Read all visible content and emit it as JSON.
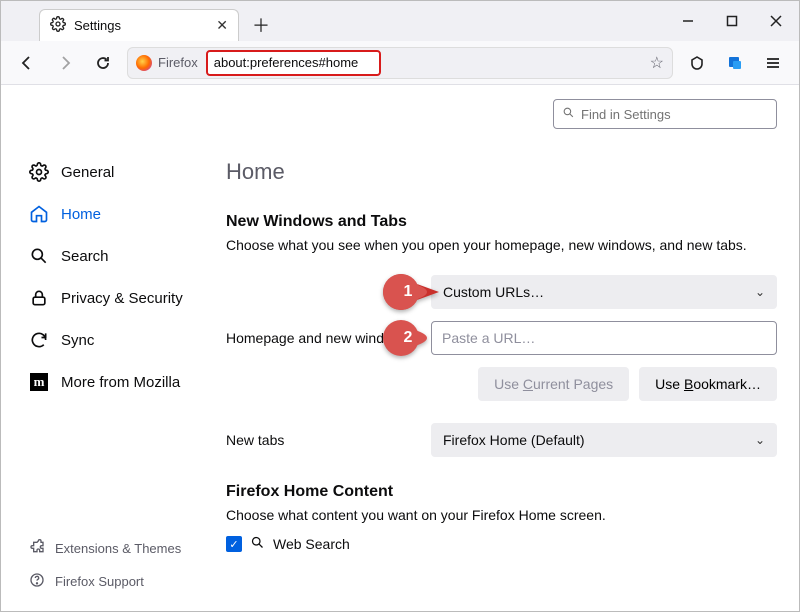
{
  "tab": {
    "title": "Settings"
  },
  "toolbar": {
    "brand": "Firefox",
    "url": "about:preferences#home"
  },
  "find": {
    "placeholder": "Find in Settings"
  },
  "sidebar": {
    "items": [
      {
        "label": "General"
      },
      {
        "label": "Home"
      },
      {
        "label": "Search"
      },
      {
        "label": "Privacy & Security"
      },
      {
        "label": "Sync"
      },
      {
        "label": "More from Mozilla"
      }
    ],
    "bottom": [
      {
        "label": "Extensions & Themes"
      },
      {
        "label": "Firefox Support"
      }
    ]
  },
  "main": {
    "title": "Home",
    "section1": {
      "title": "New Windows and Tabs",
      "desc": "Choose what you see when you open your homepage, new windows, and new tabs."
    },
    "homepage": {
      "label": "Homepage and new windows",
      "select": "Custom URLs…",
      "placeholder": "Paste a URL…"
    },
    "buttons": {
      "useCurrentPre": "Use ",
      "useCurrentU": "C",
      "useCurrentPost": "urrent Pages",
      "useBookmarkPre": "Use ",
      "useBookmarkU": "B",
      "useBookmarkPost": "ookmark…"
    },
    "newtabs": {
      "label": "New tabs",
      "select": "Firefox Home (Default)"
    },
    "section2": {
      "title": "Firefox Home Content",
      "desc": "Choose what content you want on your Firefox Home screen.",
      "webSearch": "Web Search"
    }
  },
  "callouts": {
    "one": "1",
    "two": "2"
  }
}
